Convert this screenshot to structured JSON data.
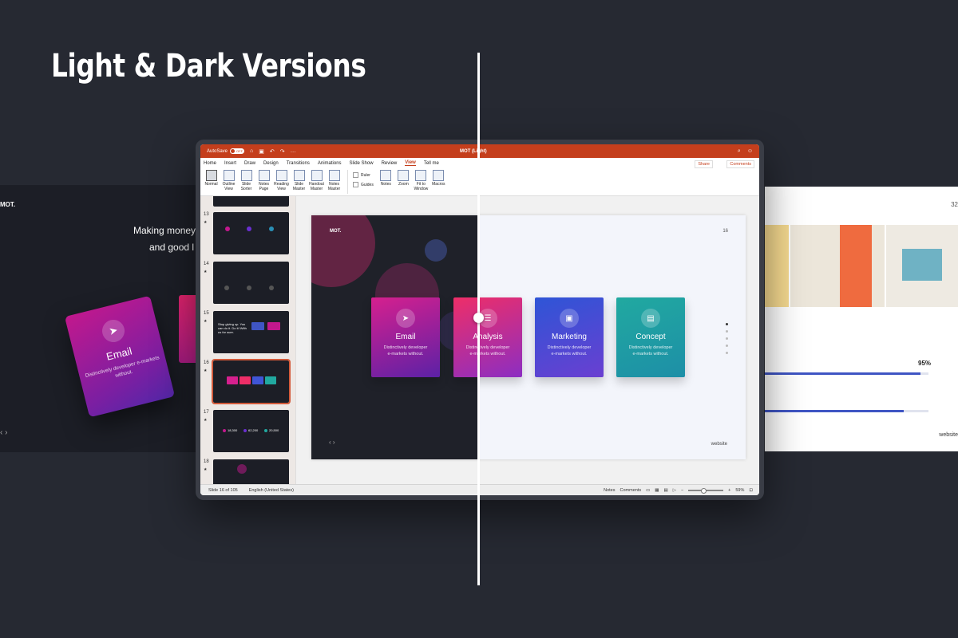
{
  "headline": "Light & Dark Versions",
  "left_slide": {
    "logo": "MOT.",
    "tagline_line1": "Making money",
    "tagline_line2": "and good l",
    "card": {
      "title": "Email",
      "desc": "Distinctively developer e-markets without."
    },
    "nav": "‹ ›"
  },
  "right_slide": {
    "page_num": "32",
    "progress_label": "95%",
    "progress1": 0.95,
    "progress2": 0.85,
    "footer": "website"
  },
  "titlebar": {
    "autosave_label": "AutoSave",
    "autosave_state": "OFF",
    "doc_title": "MOT (Light)"
  },
  "ribbon_tabs": [
    "Home",
    "Insert",
    "Draw",
    "Design",
    "Transitions",
    "Animations",
    "Slide Show",
    "Review",
    "View",
    "Tell me"
  ],
  "active_tab": "View",
  "share_label": "Share",
  "comments_label": "Comments",
  "ribbon_buttons": [
    {
      "label": "Normal",
      "sel": true
    },
    {
      "label": "Outline View"
    },
    {
      "label": "Slide Sorter"
    },
    {
      "label": "Notes Page"
    },
    {
      "label": "Reading View"
    },
    {
      "label": "Slide Master"
    },
    {
      "label": "Handout Master"
    },
    {
      "label": "Notes Master"
    }
  ],
  "ribbon_checks": [
    "Ruler",
    "Guides"
  ],
  "ribbon_buttons2": [
    {
      "label": "Notes"
    },
    {
      "label": "Zoom"
    },
    {
      "label": "Fit to Window"
    },
    {
      "label": "Macros"
    }
  ],
  "thumbnails": [
    "13",
    "14",
    "15",
    "16",
    "17",
    "18"
  ],
  "thumb15_text": "Stop giving up. You can do it. Do it! With us for sure.",
  "thumb17_stats": [
    "18,300",
    "62,200",
    "20,500"
  ],
  "slide": {
    "logo": "MOT.",
    "number": "16",
    "footer": "website",
    "nav": "‹   ›",
    "cards": [
      {
        "title": "Email",
        "desc1": "Distinctively developer",
        "desc2": "e-markets without.",
        "icon": "paper-plane-icon",
        "glyph": "➤",
        "gradient": [
          "#d6208e",
          "#5c21a6"
        ]
      },
      {
        "title": "Analysis",
        "desc1": "Distinctively developer",
        "desc2": "e-markets without.",
        "icon": "sliders-icon",
        "glyph": "☰",
        "gradient": [
          "#ee2e68",
          "#8c2ec2"
        ]
      },
      {
        "title": "Marketing",
        "desc1": "Distinctively developer",
        "desc2": "e-markets without.",
        "icon": "clipboard-icon",
        "glyph": "▣",
        "gradient": [
          "#2e55d6",
          "#6a3fd1"
        ]
      },
      {
        "title": "Concept",
        "desc1": "Distinctively developer",
        "desc2": "e-markets without.",
        "icon": "briefcase-icon",
        "glyph": "▤",
        "gradient": [
          "#21a9a0",
          "#1d8fa7"
        ]
      }
    ]
  },
  "statusbar": {
    "slide_info": "Slide 16 of 105",
    "language": "English (United States)",
    "notes": "Notes",
    "comments": "Comments",
    "zoom": "59%"
  }
}
